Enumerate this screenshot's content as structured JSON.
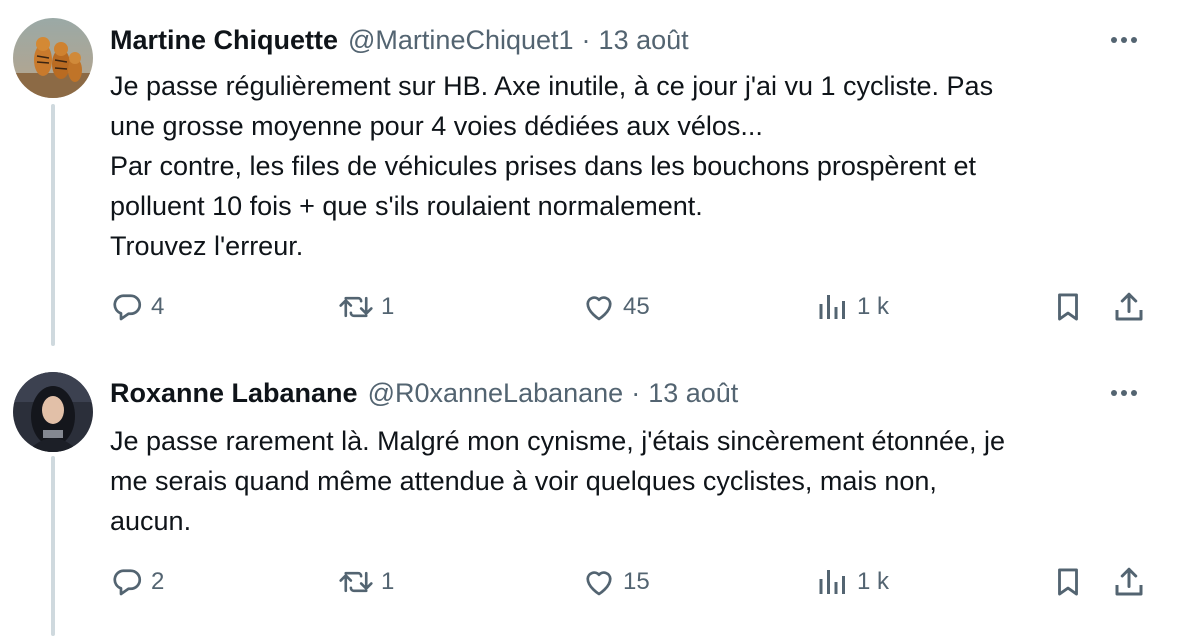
{
  "tweets": [
    {
      "display_name": "Martine Chiquette",
      "handle": "@MartineChiquet1",
      "separator": "·",
      "date": "13 août",
      "avatar_icon": "avatar-tigers-photo",
      "body": [
        "Je passe régulièrement sur HB. Axe inutile, à ce jour j'ai vu 1 cycliste. Pas",
        "une grosse moyenne pour 4 voies dédiées aux vélos...",
        "Par contre, les files de véhicules prises dans les bouchons prospèrent et",
        "polluent 10 fois + que s'ils roulaient normalement.",
        "Trouvez l'erreur."
      ],
      "stats": {
        "replies": "4",
        "reposts": "1",
        "likes": "45",
        "views": "1 k"
      }
    },
    {
      "display_name": "Roxanne Labanane",
      "handle": "@R0xanneLabanane",
      "separator": "·",
      "date": "13 août",
      "avatar_icon": "avatar-woman-photo",
      "body": [
        "Je passe rarement là. Malgré mon cynisme, j'étais sincèrement étonnée, je",
        "me serais quand même attendue à voir quelques cyclistes, mais non,",
        "aucun."
      ],
      "stats": {
        "replies": "2",
        "reposts": "1",
        "likes": "15",
        "views": "1 k"
      }
    }
  ],
  "icons": {
    "reply": "reply-icon",
    "repost": "repost-icon",
    "like": "heart-icon",
    "views": "views-icon",
    "bookmark": "bookmark-icon",
    "share": "share-icon",
    "more": "more-icon"
  },
  "colors": {
    "text_primary": "#0f1419",
    "text_secondary": "#536471",
    "thread_line": "#cfd9de",
    "background": "#ffffff"
  }
}
